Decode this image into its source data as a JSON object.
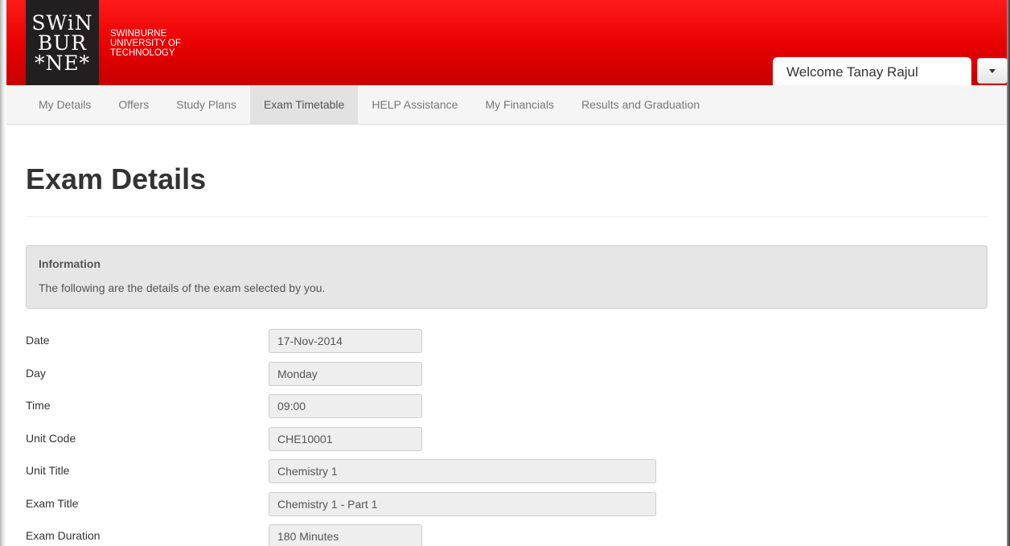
{
  "header": {
    "logo_lines": [
      "SWiN",
      "BUR",
      "*NE*"
    ],
    "brand_lines": [
      "SWINBURNE",
      "UNIVERSITY OF",
      "TECHNOLOGY"
    ],
    "welcome": "Welcome Tanay Rajul",
    "brand_color": "#e60000"
  },
  "nav": {
    "items": [
      {
        "label": "My Details"
      },
      {
        "label": "Offers"
      },
      {
        "label": "Study Plans"
      },
      {
        "label": "Exam Timetable",
        "active": true
      },
      {
        "label": "HELP Assistance"
      },
      {
        "label": "My Financials"
      },
      {
        "label": "Results and Graduation"
      }
    ]
  },
  "main": {
    "title": "Exam Details",
    "info": {
      "heading": "Information",
      "text": "The following are the details of the exam selected by you."
    },
    "fields": [
      {
        "label": "Date",
        "value": "17-Nov-2014"
      },
      {
        "label": "Day",
        "value": "Monday"
      },
      {
        "label": "Time",
        "value": "09:00"
      },
      {
        "label": "Unit Code",
        "value": "CHE10001"
      },
      {
        "label": "Unit Title",
        "value": "Chemistry 1"
      },
      {
        "label": "Exam Title",
        "value": "Chemistry 1 - Part 1"
      },
      {
        "label": "Exam Duration",
        "value": "180 Minutes"
      }
    ]
  }
}
